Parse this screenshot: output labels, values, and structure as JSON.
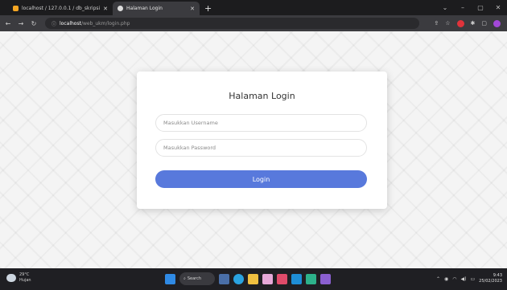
{
  "browser": {
    "tabs": [
      {
        "title": "localhost / 127.0.0.1 / db_skripsi"
      },
      {
        "title": "Halaman Login"
      }
    ],
    "new_tab": "+",
    "url": {
      "host": "localhost",
      "path": "/web_ukm/login.php"
    }
  },
  "login": {
    "heading": "Halaman Login",
    "username_placeholder": "Masukkan Username",
    "password_placeholder": "Masukkan Password",
    "button_label": "Login"
  },
  "taskbar": {
    "weather_temp": "29°C",
    "weather_desc": "Hujan",
    "search_label": "Search",
    "time": "9:43",
    "date": "25/02/2023"
  },
  "colors": {
    "accent": "#5879dc",
    "tabbar": "#1c1c1e",
    "taskbar": "#1f1f23"
  }
}
